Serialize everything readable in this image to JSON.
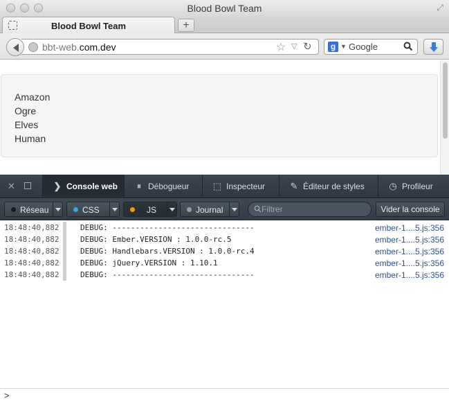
{
  "window": {
    "title": "Blood Bowl Team"
  },
  "tab": {
    "label": "Blood Bowl Team"
  },
  "navbar": {
    "url_prefix": "bbt-web.",
    "url_domain": "com.dev",
    "search_placeholder": "Google"
  },
  "page": {
    "races": [
      "Amazon",
      "Ogre",
      "Elves",
      "Human"
    ]
  },
  "devtools": {
    "tabs": [
      {
        "label": "Console web",
        "icon": "chevron-right-icon"
      },
      {
        "label": "Débogueur",
        "icon": "pause-icon"
      },
      {
        "label": "Inspecteur",
        "icon": "inspector-icon"
      },
      {
        "label": "Éditeur de styles",
        "icon": "style-editor-icon"
      },
      {
        "label": "Profileur",
        "icon": "stopwatch-icon"
      }
    ],
    "filters": [
      {
        "label": "Réseau",
        "color": "#1a1a1a"
      },
      {
        "label": "CSS",
        "color": "#2fa8e0"
      },
      {
        "label": "JS",
        "color": "#f0a000"
      },
      {
        "label": "Journal",
        "color": "#9a9a9a"
      }
    ],
    "filter_placeholder": "Filtrer",
    "clear_label": "Vider la console",
    "logs": [
      {
        "time": "18:48:40,882",
        "msg": "DEBUG: -------------------------------",
        "src": "ember-1....5.js:356"
      },
      {
        "time": "18:48:40,882",
        "msg": "DEBUG: Ember.VERSION : 1.0.0-rc.5",
        "src": "ember-1....5.js:356"
      },
      {
        "time": "18:48:40,882",
        "msg": "DEBUG: Handlebars.VERSION : 1.0.0-rc.4",
        "src": "ember-1....5.js:356"
      },
      {
        "time": "18:48:40,882",
        "msg": "DEBUG: jQuery.VERSION : 1.10.1",
        "src": "ember-1....5.js:356"
      },
      {
        "time": "18:48:40,882",
        "msg": "DEBUG: -------------------------------",
        "src": "ember-1....5.js:356"
      }
    ]
  }
}
